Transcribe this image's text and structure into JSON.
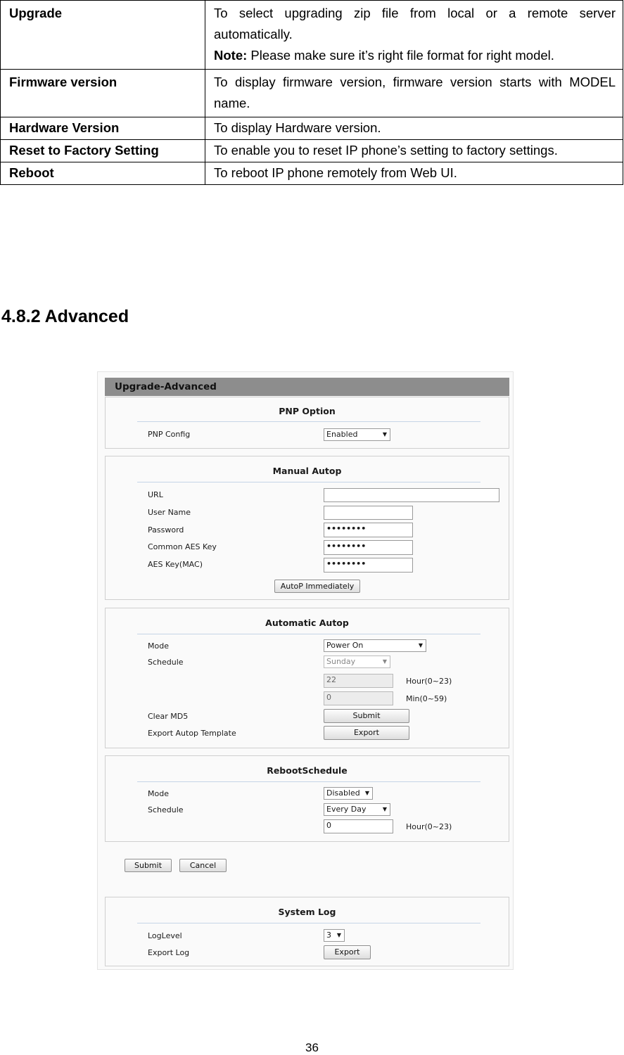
{
  "table": {
    "rows": [
      {
        "label": "Upgrade",
        "desc": "To select upgrading zip file from local or a remote server automatically.",
        "note_label": "Note:",
        "note_text": " Please make sure it’s right file format for right model."
      },
      {
        "label": "Firmware version",
        "desc": "To display firmware version, firmware version starts with MODEL name."
      },
      {
        "label": "Hardware Version",
        "desc": "To display Hardware version."
      },
      {
        "label": "Reset to Factory Setting",
        "desc": "To enable you to reset IP phone’s setting to factory settings."
      },
      {
        "label": "Reboot",
        "desc": "To reboot IP phone remotely from Web UI."
      }
    ]
  },
  "section_heading": "4.8.2 Advanced",
  "screenshot": {
    "title": "Upgrade-Advanced",
    "pnp": {
      "title": "PNP Option",
      "config_label": "PNP Config",
      "config_value": "Enabled"
    },
    "manual": {
      "title": "Manual Autop",
      "url_label": "URL",
      "url_value": "",
      "username_label": "User Name",
      "username_value": "",
      "password_label": "Password",
      "password_value": "••••••••",
      "aes_label": "Common AES Key",
      "aes_value": "••••••••",
      "aes_mac_label": "AES Key(MAC)",
      "aes_mac_value": "••••••••",
      "button": "AutoP Immediately"
    },
    "automatic": {
      "title": "Automatic Autop",
      "mode_label": "Mode",
      "mode_value": "Power On",
      "schedule_label": "Schedule",
      "schedule_value": "Sunday",
      "hour_value": "22",
      "hour_unit": "Hour(0~23)",
      "min_value": "0",
      "min_unit": "Min(0~59)",
      "clear_label": "Clear MD5",
      "clear_button": "Submit",
      "export_label": "Export Autop Template",
      "export_button": "Export"
    },
    "reboot": {
      "title": "RebootSchedule",
      "mode_label": "Mode",
      "mode_value": "Disabled",
      "schedule_label": "Schedule",
      "schedule_value": "Every Day",
      "hour_value": "0",
      "hour_unit": "Hour(0~23)"
    },
    "submit_button": "Submit",
    "cancel_button": "Cancel",
    "syslog": {
      "title": "System Log",
      "level_label": "LogLevel",
      "level_value": "3",
      "export_label": "Export Log",
      "export_button": "Export"
    },
    "dropdown_arrow": "▼"
  },
  "page_number": "36"
}
